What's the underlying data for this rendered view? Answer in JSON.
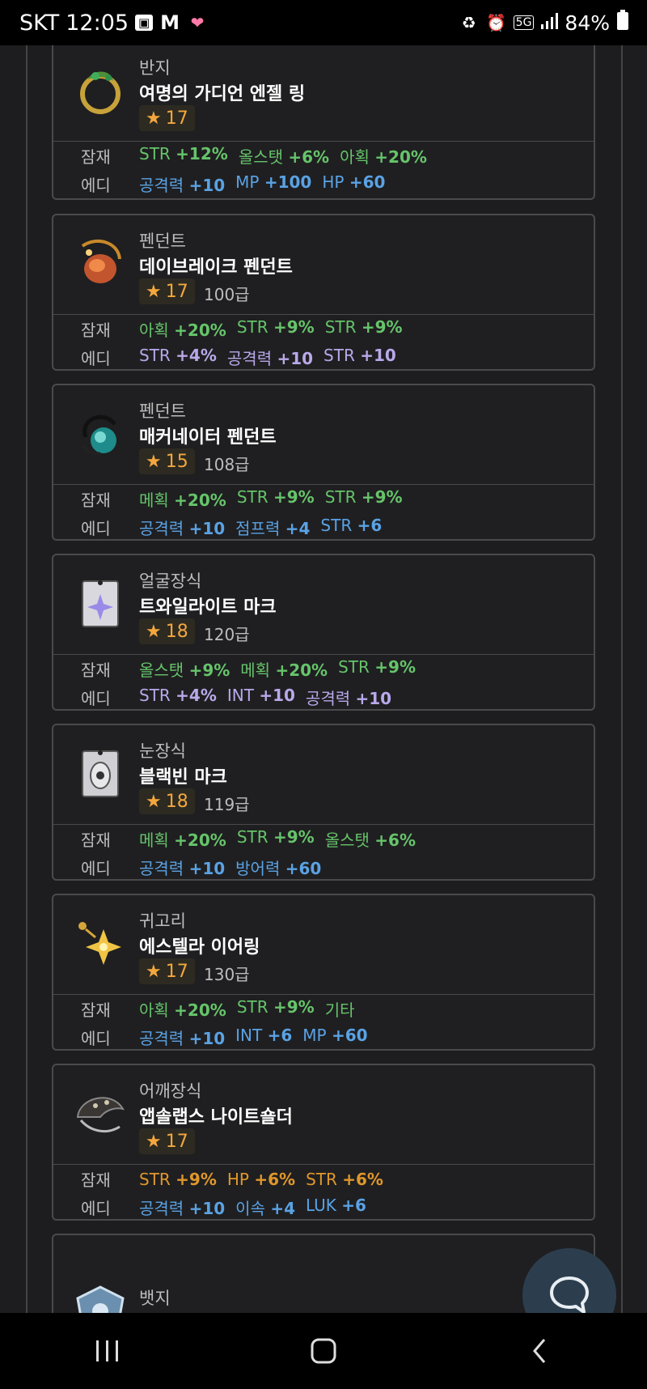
{
  "status_bar": {
    "carrier": "SKT",
    "time": "12:05",
    "network": "5G",
    "battery": "84%"
  },
  "items": [
    {
      "category": "반지",
      "name": "여명의 가디언 엔젤 링",
      "stars": "17",
      "level": "",
      "potential_label": "잠재",
      "additional_label": "에디",
      "potential": [
        {
          "stat": "STR",
          "value": "+12%",
          "color": "g"
        },
        {
          "stat": "올스탯",
          "value": "+6%",
          "color": "g"
        },
        {
          "stat": "아획",
          "value": "+20%",
          "color": "g"
        }
      ],
      "additional": [
        {
          "stat": "공격력",
          "value": "+10",
          "color": "b"
        },
        {
          "stat": "MP",
          "value": "+100",
          "color": "b"
        },
        {
          "stat": "HP",
          "value": "+60",
          "color": "b"
        }
      ]
    },
    {
      "category": "펜던트",
      "name": "데이브레이크 펜던트",
      "stars": "17",
      "level": "100급",
      "potential_label": "잠재",
      "additional_label": "에디",
      "potential": [
        {
          "stat": "아획",
          "value": "+20%",
          "color": "g"
        },
        {
          "stat": "STR",
          "value": "+9%",
          "color": "g"
        },
        {
          "stat": "STR",
          "value": "+9%",
          "color": "g"
        }
      ],
      "additional": [
        {
          "stat": "STR",
          "value": "+4%",
          "color": "p"
        },
        {
          "stat": "공격력",
          "value": "+10",
          "color": "p"
        },
        {
          "stat": "STR",
          "value": "+10",
          "color": "p"
        }
      ]
    },
    {
      "category": "펜던트",
      "name": "매커네이터 펜던트",
      "stars": "15",
      "level": "108급",
      "potential_label": "잠재",
      "additional_label": "에디",
      "potential": [
        {
          "stat": "메획",
          "value": "+20%",
          "color": "g"
        },
        {
          "stat": "STR",
          "value": "+9%",
          "color": "g"
        },
        {
          "stat": "STR",
          "value": "+9%",
          "color": "g"
        }
      ],
      "additional": [
        {
          "stat": "공격력",
          "value": "+10",
          "color": "b"
        },
        {
          "stat": "점프력",
          "value": "+4",
          "color": "b"
        },
        {
          "stat": "STR",
          "value": "+6",
          "color": "b"
        }
      ]
    },
    {
      "category": "얼굴장식",
      "name": "트와일라이트 마크",
      "stars": "18",
      "level": "120급",
      "potential_label": "잠재",
      "additional_label": "에디",
      "potential": [
        {
          "stat": "올스탯",
          "value": "+9%",
          "color": "g"
        },
        {
          "stat": "메획",
          "value": "+20%",
          "color": "g"
        },
        {
          "stat": "STR",
          "value": "+9%",
          "color": "g"
        }
      ],
      "additional": [
        {
          "stat": "STR",
          "value": "+4%",
          "color": "p"
        },
        {
          "stat": "INT",
          "value": "+10",
          "color": "p"
        },
        {
          "stat": "공격력",
          "value": "+10",
          "color": "p"
        }
      ]
    },
    {
      "category": "눈장식",
      "name": "블랙빈 마크",
      "stars": "18",
      "level": "119급",
      "potential_label": "잠재",
      "additional_label": "에디",
      "potential": [
        {
          "stat": "메획",
          "value": "+20%",
          "color": "g"
        },
        {
          "stat": "STR",
          "value": "+9%",
          "color": "g"
        },
        {
          "stat": "올스탯",
          "value": "+6%",
          "color": "g"
        }
      ],
      "additional": [
        {
          "stat": "공격력",
          "value": "+10",
          "color": "b"
        },
        {
          "stat": "방어력",
          "value": "+60",
          "color": "b"
        }
      ]
    },
    {
      "category": "귀고리",
      "name": "에스텔라 이어링",
      "stars": "17",
      "level": "130급",
      "potential_label": "잠재",
      "additional_label": "에디",
      "potential": [
        {
          "stat": "아획",
          "value": "+20%",
          "color": "g"
        },
        {
          "stat": "STR",
          "value": "+9%",
          "color": "g"
        },
        {
          "stat": "기타",
          "value": "",
          "color": "g"
        }
      ],
      "additional": [
        {
          "stat": "공격력",
          "value": "+10",
          "color": "b"
        },
        {
          "stat": "INT",
          "value": "+6",
          "color": "b"
        },
        {
          "stat": "MP",
          "value": "+60",
          "color": "b"
        }
      ]
    },
    {
      "category": "어깨장식",
      "name": "앱솔랩스 나이트숄더",
      "stars": "17",
      "level": "",
      "potential_label": "잠재",
      "additional_label": "에디",
      "potential": [
        {
          "stat": "STR",
          "value": "+9%",
          "color": "o"
        },
        {
          "stat": "HP",
          "value": "+6%",
          "color": "o"
        },
        {
          "stat": "STR",
          "value": "+6%",
          "color": "o"
        }
      ],
      "additional": [
        {
          "stat": "공격력",
          "value": "+10",
          "color": "b"
        },
        {
          "stat": "이속",
          "value": "+4",
          "color": "b"
        },
        {
          "stat": "LUK",
          "value": "+6",
          "color": "b"
        }
      ]
    },
    {
      "category": "뱃지",
      "name": "",
      "stars": "",
      "level": "",
      "potential_label": "",
      "additional_label": "",
      "potential": [],
      "additional": []
    }
  ]
}
